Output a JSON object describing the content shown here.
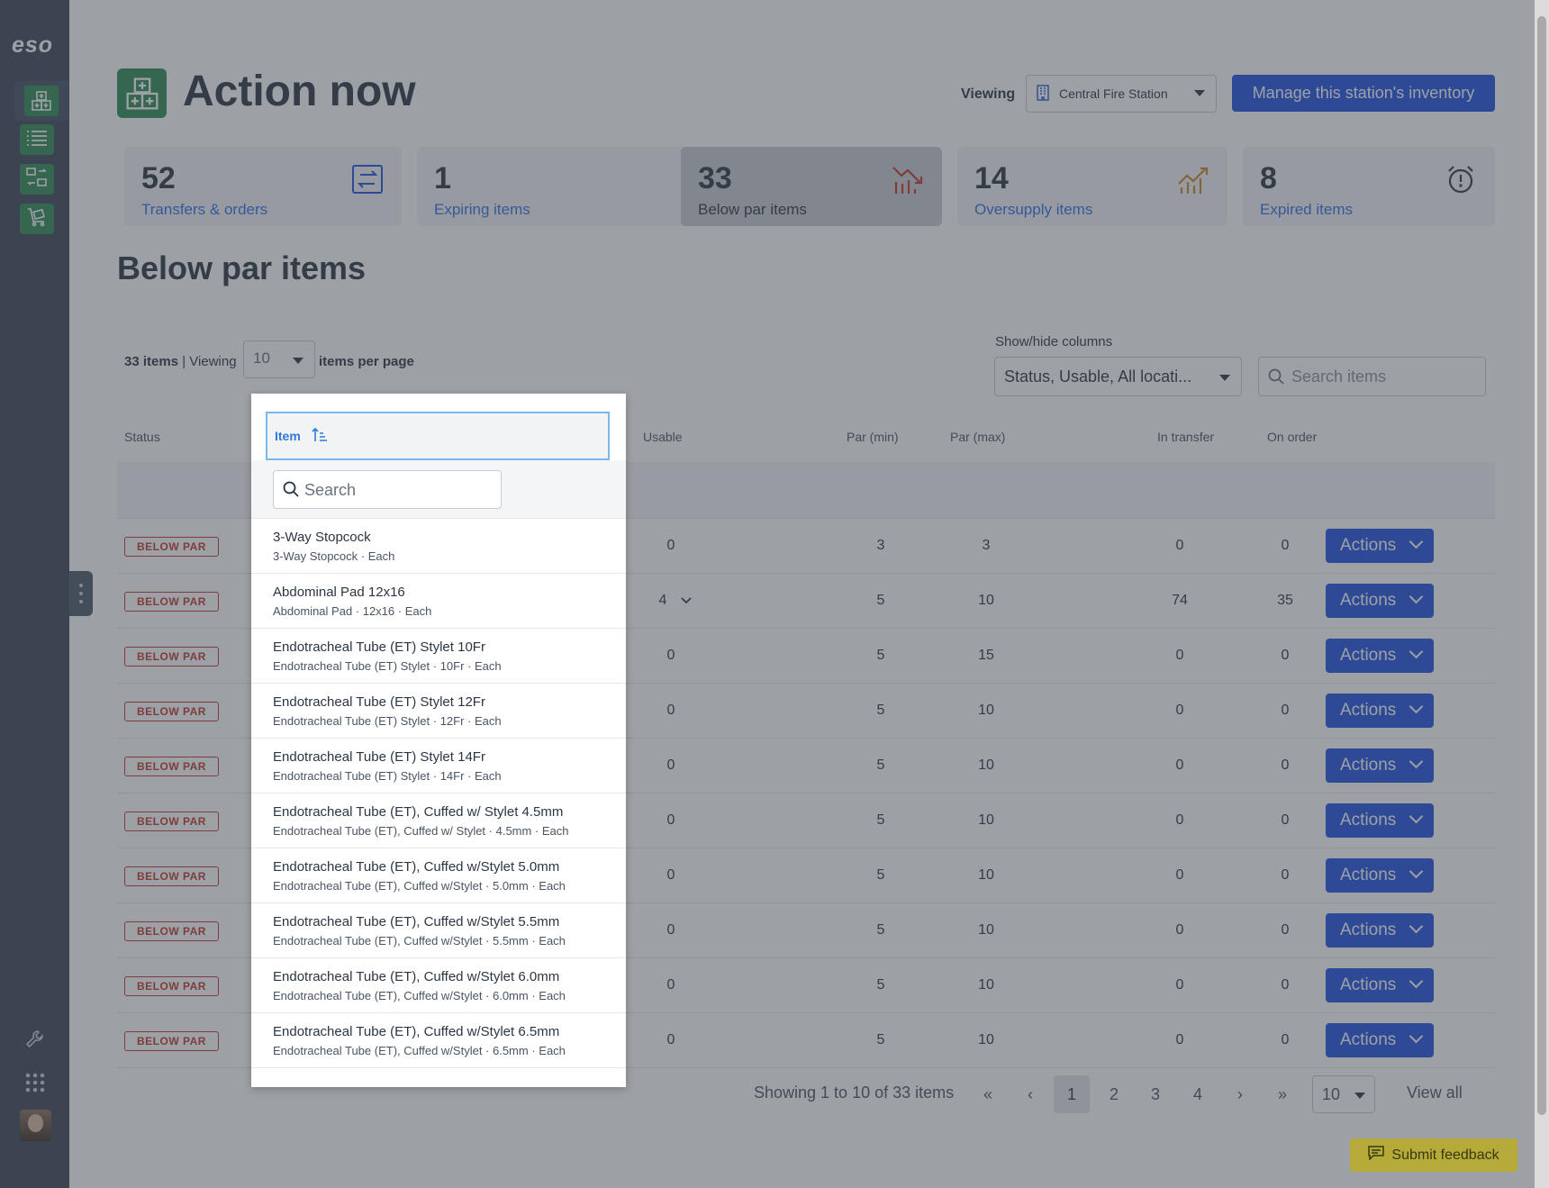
{
  "app": {
    "logo": "eso"
  },
  "header": {
    "title": "Action now",
    "viewing_label": "Viewing",
    "station": "Central Fire Station",
    "manage_button": "Manage this station's inventory"
  },
  "cards": [
    {
      "count": "52",
      "label": "Transfers & orders",
      "icon": "transfer-icon"
    },
    {
      "count": "1",
      "label": "Expiring items",
      "icon": "alarm-clock-icon"
    },
    {
      "count": "33",
      "label": "Below par items",
      "icon": "chart-down-icon"
    },
    {
      "count": "14",
      "label": "Oversupply items",
      "icon": "chart-up-icon"
    },
    {
      "count": "8",
      "label": "Expired items",
      "icon": "alarm-alert-icon"
    }
  ],
  "section_title": "Below par items",
  "toolbar": {
    "count_text": "33 items",
    "viewing_text": "Viewing",
    "per_page": "10",
    "per_page_suffix": "items per page",
    "columns_label": "Show/hide columns",
    "columns_value": "Status, Usable, All locati...",
    "search_placeholder": "Search items"
  },
  "table": {
    "headers": {
      "status": "Status",
      "item": "Item",
      "usable": "Usable",
      "par_min": "Par (min)",
      "par_max": "Par (max)",
      "in_transfer": "In transfer",
      "on_order": "On order"
    },
    "item_search_placeholder": "Search",
    "rows": [
      {
        "status": "BELOW PAR",
        "name": "3-Way Stopcock",
        "desc": "3-Way Stopcock · Each",
        "usable": "0",
        "par_min": "3",
        "par_max": "3",
        "in_transfer": "0",
        "on_order": "0",
        "action": "Actions"
      },
      {
        "status": "BELOW PAR",
        "name": "Abdominal Pad 12x16",
        "desc": "Abdominal Pad · 12x16 · Each",
        "usable": "4",
        "par_min": "5",
        "par_max": "10",
        "in_transfer": "74",
        "on_order": "35",
        "action": "Actions"
      },
      {
        "status": "BELOW PAR",
        "name": "Endotracheal Tube (ET) Stylet 10Fr",
        "desc": "Endotracheal Tube (ET) Stylet · 10Fr · Each",
        "usable": "0",
        "par_min": "5",
        "par_max": "15",
        "in_transfer": "0",
        "on_order": "0",
        "action": "Actions"
      },
      {
        "status": "BELOW PAR",
        "name": "Endotracheal Tube (ET) Stylet 12Fr",
        "desc": "Endotracheal Tube (ET) Stylet · 12Fr · Each",
        "usable": "0",
        "par_min": "5",
        "par_max": "10",
        "in_transfer": "0",
        "on_order": "0",
        "action": "Actions"
      },
      {
        "status": "BELOW PAR",
        "name": "Endotracheal Tube (ET) Stylet 14Fr",
        "desc": "Endotracheal Tube (ET) Stylet · 14Fr · Each",
        "usable": "0",
        "par_min": "5",
        "par_max": "10",
        "in_transfer": "0",
        "on_order": "0",
        "action": "Actions"
      },
      {
        "status": "BELOW PAR",
        "name": "Endotracheal Tube (ET), Cuffed w/ Stylet 4.5mm",
        "desc": "Endotracheal Tube (ET), Cuffed w/ Stylet · 4.5mm · Each",
        "usable": "0",
        "par_min": "5",
        "par_max": "10",
        "in_transfer": "0",
        "on_order": "0",
        "action": "Actions"
      },
      {
        "status": "BELOW PAR",
        "name": "Endotracheal Tube (ET), Cuffed w/Stylet 5.0mm",
        "desc": "Endotracheal Tube (ET), Cuffed w/Stylet · 5.0mm · Each",
        "usable": "0",
        "par_min": "5",
        "par_max": "10",
        "in_transfer": "0",
        "on_order": "0",
        "action": "Actions"
      },
      {
        "status": "BELOW PAR",
        "name": "Endotracheal Tube (ET), Cuffed w/Stylet 5.5mm",
        "desc": "Endotracheal Tube (ET), Cuffed w/Stylet · 5.5mm · Each",
        "usable": "0",
        "par_min": "5",
        "par_max": "10",
        "in_transfer": "0",
        "on_order": "0",
        "action": "Actions"
      },
      {
        "status": "BELOW PAR",
        "name": "Endotracheal Tube (ET), Cuffed w/Stylet 6.0mm",
        "desc": "Endotracheal Tube (ET), Cuffed w/Stylet · 6.0mm · Each",
        "usable": "0",
        "par_min": "5",
        "par_max": "10",
        "in_transfer": "0",
        "on_order": "0",
        "action": "Actions"
      },
      {
        "status": "BELOW PAR",
        "name": "Endotracheal Tube (ET), Cuffed w/Stylet 6.5mm",
        "desc": "Endotracheal Tube (ET), Cuffed w/Stylet · 6.5mm · Each",
        "usable": "0",
        "par_min": "5",
        "par_max": "10",
        "in_transfer": "0",
        "on_order": "0",
        "action": "Actions"
      }
    ]
  },
  "pagination": {
    "summary": "Showing 1 to 10 of 33 items",
    "first": "«",
    "prev": "‹",
    "pages": [
      "1",
      "2",
      "3",
      "4"
    ],
    "next": "›",
    "last": "»",
    "page_size": "10",
    "view_all": "View all"
  },
  "feedback": "Submit feedback",
  "colors": {
    "sidebar": "#3c4757",
    "brand_green": "#2f8a55",
    "primary": "#2152e0",
    "danger": "#c0392b",
    "feedback": "#f3e34b"
  }
}
